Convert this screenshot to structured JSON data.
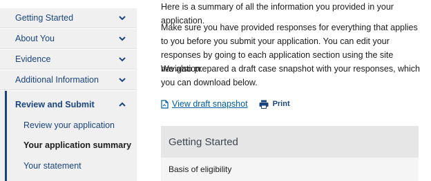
{
  "sidebar": {
    "items": [
      {
        "label": "Getting Started",
        "icon": "chevron-down-icon"
      },
      {
        "label": "About You",
        "icon": "chevron-down-icon"
      },
      {
        "label": "Evidence",
        "icon": "chevron-down-icon"
      },
      {
        "label": "Additional Information",
        "icon": "chevron-down-icon"
      }
    ],
    "active": {
      "label": "Review and Submit",
      "icon": "chevron-up-icon",
      "subitems": [
        {
          "label": "Review your application"
        },
        {
          "label": "Your application summary",
          "current": true
        },
        {
          "label": "Your statement"
        }
      ]
    }
  },
  "main": {
    "intro": "Here is a summary of all the information you provided in your application.",
    "instructions": "Make sure you have provided responses for everything that applies to you before you submit your application. You can edit your responses by going to each application section using the site navigation.",
    "draft_note": "We also prepared a draft case snapshot with your responses, which you can download below.",
    "download_link": "View draft snapshot",
    "print_link": "Print",
    "section": {
      "title": "Getting Started",
      "row": "Basis of eligibility"
    }
  },
  "colors": {
    "primary": "#1a4480",
    "link": "#005ea2",
    "sidebar_bg": "#f0f0f0",
    "section_header_bg": "#e6e6e6"
  }
}
